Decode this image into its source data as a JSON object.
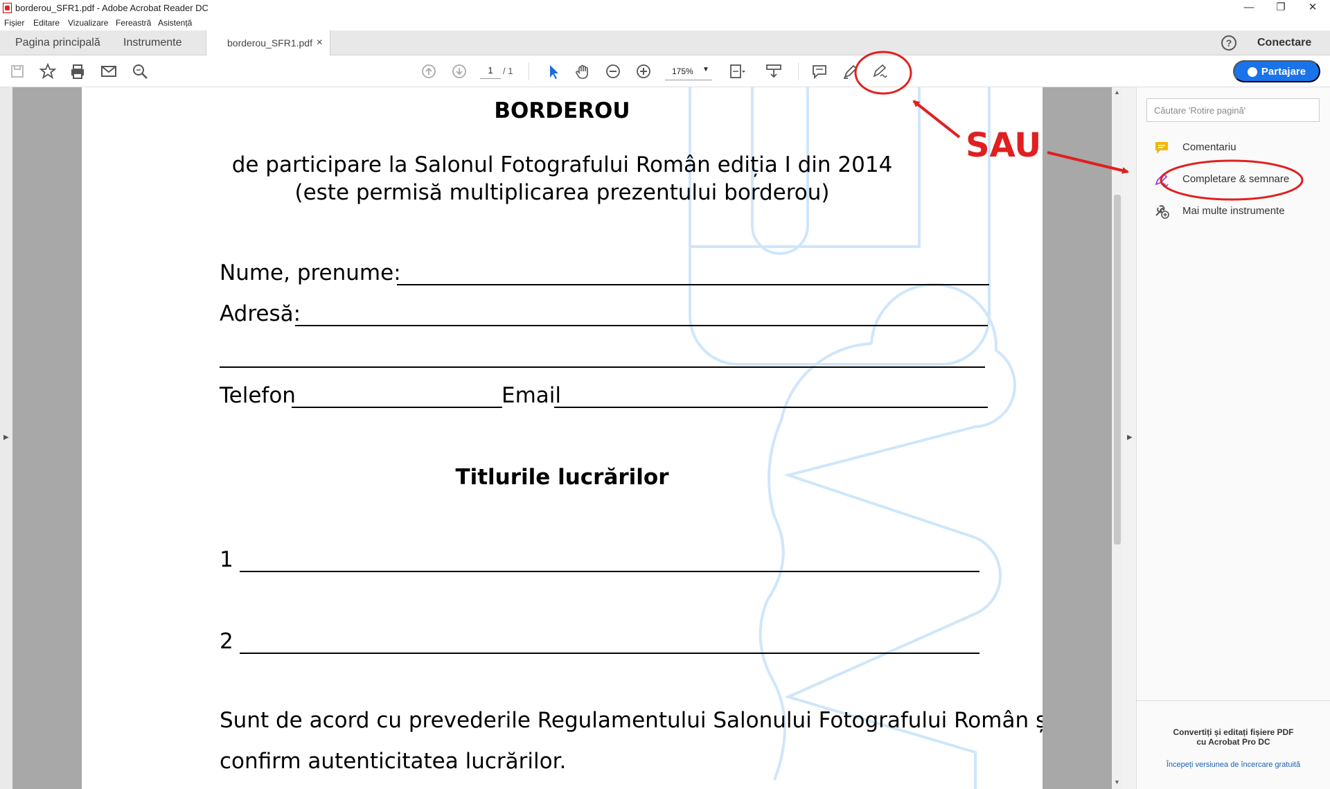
{
  "window": {
    "title": "borderou_SFR1.pdf - Adobe Acrobat Reader DC",
    "controls": [
      "—",
      "❐",
      "✕"
    ]
  },
  "menu": [
    "Fișier",
    "Editare",
    "Vizualizare",
    "Fereastră",
    "Asistență"
  ],
  "tabs": {
    "home": "Pagina principală",
    "tools": "Instrumente",
    "document": "borderou_SFR1.pdf",
    "close": "×"
  },
  "header_right": {
    "help": "?",
    "signin": "Conectare"
  },
  "toolbar": {
    "page_current": "1",
    "page_total": "/ 1",
    "zoom": "175%",
    "share_label": "Partajare"
  },
  "document": {
    "title": "BORDEROU",
    "subtitle_line1": "de participare la Salonul Fotografului Român ediția I din 2014",
    "subtitle_line2": "(este permisă multiplicarea prezentului borderou)",
    "field_name": "Nume, prenume:",
    "field_address": "Adresă:",
    "field_phone": "Telefon",
    "field_email": "Email",
    "works_heading": "Titlurile lucrărilor",
    "work_1": "1",
    "work_2": "2",
    "agreement_line1": "Sunt de acord cu prevederile Regulamentului Salonului Fotografului Român și",
    "agreement_line2": "confirm autenticitatea lucrărilor."
  },
  "annotation": {
    "label": "SAU",
    "color": "#e02020"
  },
  "right_pane": {
    "search_placeholder": "Căutare 'Rotire pagină'",
    "items": [
      {
        "label": "Comentariu",
        "icon": "comment-icon"
      },
      {
        "label": "Completare & semnare",
        "icon": "fill-sign-icon"
      },
      {
        "label": "Mai multe instrumente",
        "icon": "more-tools-icon"
      }
    ],
    "promo_line1": "Convertiți și editați fișiere PDF",
    "promo_line2": "cu Acrobat Pro DC",
    "promo_link": "Începeți versiunea de încercare gratuită"
  },
  "colors": {
    "accent": "#1a73e8",
    "annotation": "#e02020",
    "watermark": "#cfe6fb"
  }
}
